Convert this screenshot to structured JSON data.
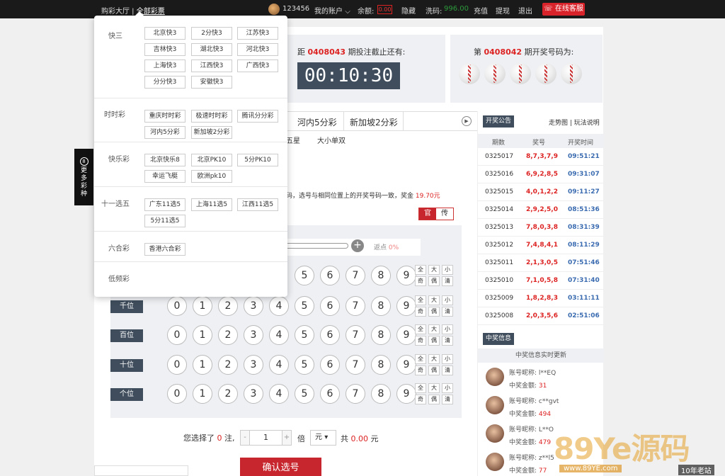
{
  "topbar": {
    "hall": "购彩大厅",
    "all_lottery": "全部彩票",
    "username": "123456",
    "my_account": "我的账户",
    "balance_label": "余额:",
    "balance": "0.00",
    "hide": "隐藏",
    "code_label": "洗码:",
    "code_value": "996.00",
    "recharge": "充值",
    "withdraw": "提现",
    "logout": "退出",
    "support": "在线客服"
  },
  "period": {
    "prefix": "距",
    "number": "0408043",
    "suffix": "期投注截止还有:",
    "countdown": "00:10:30"
  },
  "draw": {
    "prefix": "第",
    "number": "0408042",
    "suffix": "期开奖号码为:"
  },
  "tabs": [
    "河内5分彩",
    "新加坡2分彩"
  ],
  "subtabs": [
    "五星",
    "大小单双"
  ],
  "rule": {
    "text": "码，选号与相同位置上的开奖号码一致，奖金",
    "prize": "19.70元"
  },
  "mode": {
    "on": "官",
    "off": "传"
  },
  "rebate": {
    "label": "返点",
    "value": "0%"
  },
  "positions": [
    "千位",
    "百位",
    "十位",
    "个位"
  ],
  "digits": [
    "0",
    "1",
    "2",
    "3",
    "4",
    "5",
    "6",
    "7",
    "8",
    "9"
  ],
  "quick": [
    "全",
    "大",
    "小",
    "奇",
    "偶",
    "清"
  ],
  "summary": {
    "selected_prefix": "您选择了",
    "count": "0",
    "unit": "注,",
    "multiple": "1",
    "times": "倍",
    "currency": "元",
    "total_prefix": "共",
    "total": "0.00",
    "total_unit": "元"
  },
  "confirm": "确认选号",
  "right": {
    "badge_draw": "开奖公告",
    "trend": "走势图",
    "rules": "玩法说明",
    "history_headers": [
      "期数",
      "奖号",
      "开奖时间"
    ],
    "history": [
      {
        "period": "0325017",
        "numbers": "8,7,3,7,9",
        "time": "09:51:21"
      },
      {
        "period": "0325016",
        "numbers": "6,9,2,8,5",
        "time": "09:31:07"
      },
      {
        "period": "0325015",
        "numbers": "4,0,1,2,2",
        "time": "09:11:27"
      },
      {
        "period": "0325014",
        "numbers": "2,9,2,5,0",
        "time": "08:51:36"
      },
      {
        "period": "0325013",
        "numbers": "7,8,0,3,8",
        "time": "08:31:39"
      },
      {
        "period": "0325012",
        "numbers": "7,4,8,4,1",
        "time": "08:11:29"
      },
      {
        "period": "0325011",
        "numbers": "2,1,3,0,5",
        "time": "07:51:46"
      },
      {
        "period": "0325010",
        "numbers": "7,1,0,5,8",
        "time": "07:31:40"
      },
      {
        "period": "0325009",
        "numbers": "1,8,2,8,3",
        "time": "03:11:11"
      },
      {
        "period": "0325008",
        "numbers": "2,0,3,5,6",
        "time": "02:51:06"
      }
    ],
    "badge_win": "中奖信息",
    "win_sub": "中奖信息实时更新",
    "winners": [
      {
        "nick_label": "账号昵称:",
        "nick": "l**EQ",
        "amount_label": "中奖金额:",
        "amount": "31"
      },
      {
        "nick_label": "账号昵称:",
        "nick": "c**gvt",
        "amount_label": "中奖金额:",
        "amount": "494"
      },
      {
        "nick_label": "账号昵称:",
        "nick": "L**O",
        "amount_label": "中奖金额:",
        "amount": "479"
      },
      {
        "nick_label": "账号昵称:",
        "nick": "z**l5",
        "amount_label": "中奖金额:",
        "amount": "77"
      }
    ]
  },
  "side_tab": {
    "icon": "8",
    "text": "更多彩种"
  },
  "dropdown": {
    "categories": [
      {
        "name": "快三",
        "items": [
          "北京快3",
          "2分快3",
          "江苏快3",
          "吉林快3",
          "湖北快3",
          "河北快3",
          "上海快3",
          "江西快3",
          "广西快3",
          "分分快3",
          "安徽快3"
        ]
      },
      {
        "name": "时时彩",
        "items": [
          "重庆时时彩",
          "极速时时彩",
          "腾讯分分彩",
          "河内5分彩",
          "新加坡2分彩"
        ]
      },
      {
        "name": "快乐彩",
        "items": [
          "北京快乐8",
          "北京PK10",
          "5分PK10",
          "幸运飞艇",
          "欧洲pk10"
        ]
      },
      {
        "name": "十一选五",
        "items": [
          "广东11选5",
          "上海11选5",
          "江西11选5",
          "5分11选5"
        ]
      },
      {
        "name": "六合彩",
        "items": [
          "香港六合彩"
        ]
      },
      {
        "name": "低频彩",
        "items": []
      }
    ]
  },
  "watermark": {
    "brand": "89Ye源码",
    "url": "www.89YE.com",
    "slogan": "10年老站"
  },
  "colors": {
    "accent": "#c8262e",
    "dark": "#3f4d5c",
    "time_blue": "#3a6bb0"
  }
}
